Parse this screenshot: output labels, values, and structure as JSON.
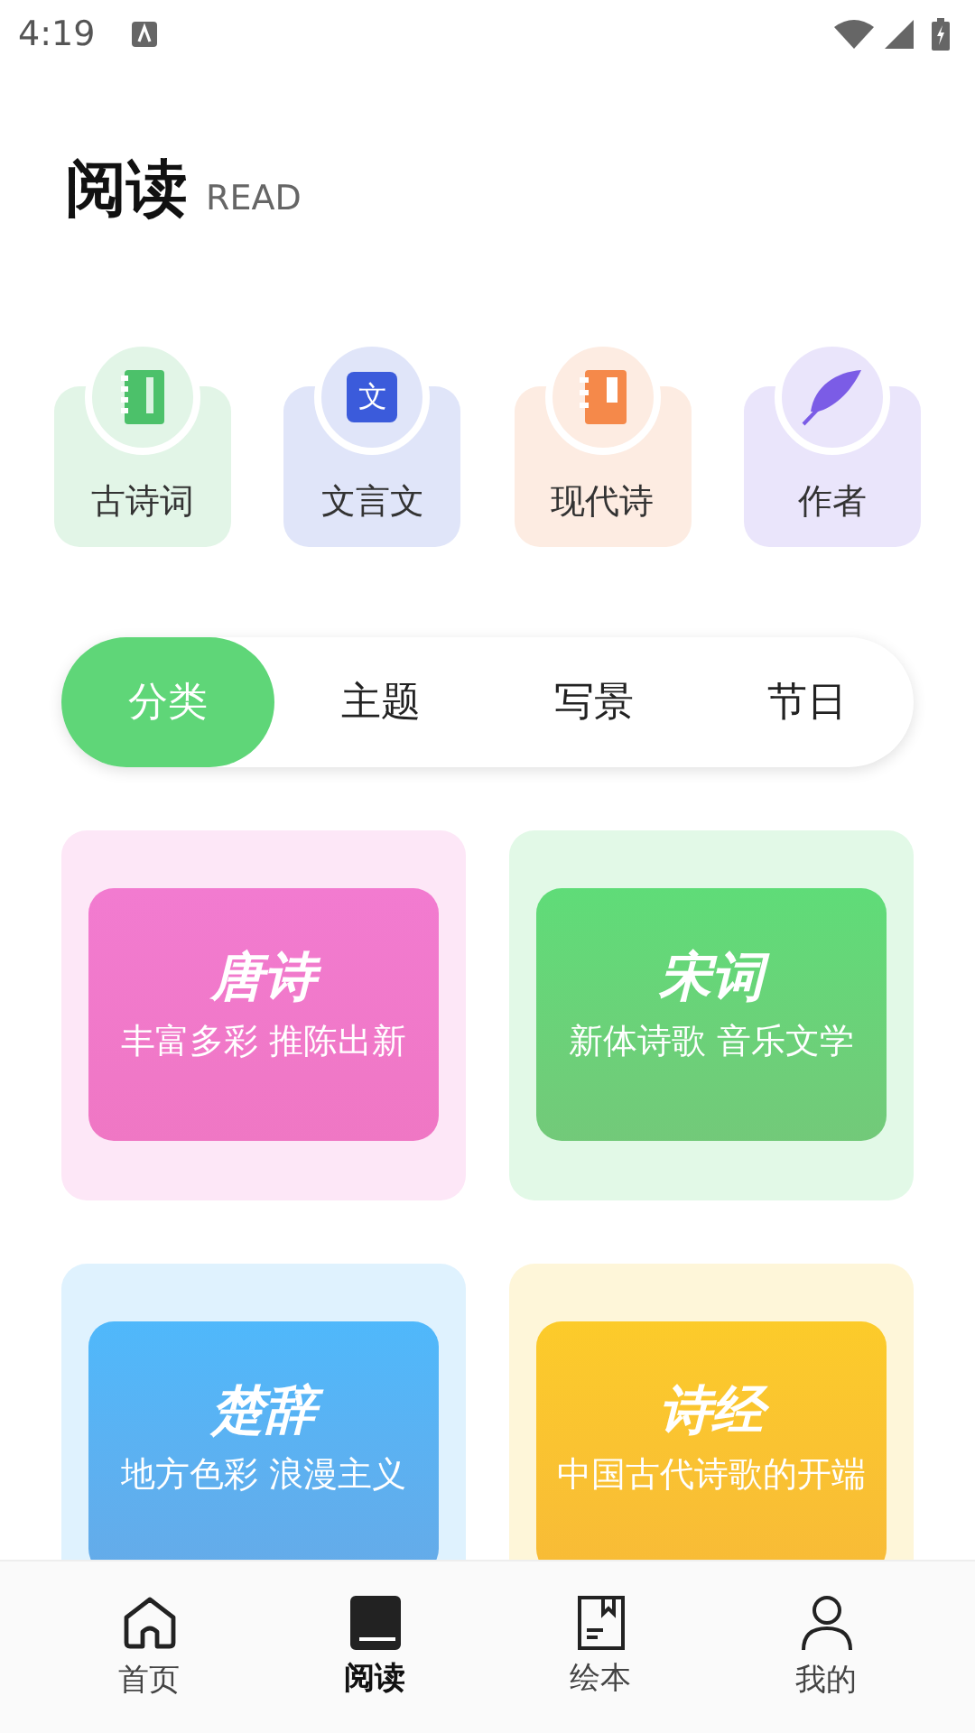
{
  "status_bar": {
    "time": "4:19"
  },
  "header": {
    "title": "阅读",
    "subtitle": "READ"
  },
  "categories": [
    {
      "label": "古诗词",
      "kind": "notebook",
      "color": "#4cc16a"
    },
    {
      "label": "文言文",
      "kind": "glyph",
      "glyph": "文",
      "color": "#3b5bdb"
    },
    {
      "label": "现代诗",
      "kind": "book",
      "color": "#f5894a"
    },
    {
      "label": "作者",
      "kind": "feather",
      "color": "#7b5ce6"
    }
  ],
  "tabs": [
    {
      "label": "分类",
      "selected": true
    },
    {
      "label": "主题",
      "selected": false
    },
    {
      "label": "写景",
      "selected": false
    },
    {
      "label": "节日",
      "selected": false
    }
  ],
  "cards": [
    {
      "title": "唐诗",
      "subtitle": "丰富多彩 推陈出新",
      "color": "#f27bd0"
    },
    {
      "title": "宋词",
      "subtitle": "新体诗歌 音乐文学",
      "color": "#5fdc78"
    },
    {
      "title": "楚辞",
      "subtitle": "地方色彩 浪漫主义",
      "color": "#4fb8fb"
    },
    {
      "title": "诗经",
      "subtitle": "中国古代诗歌的开端",
      "color": "#fccb2a"
    }
  ],
  "bottom_nav": [
    {
      "label": "首页",
      "kind": "home",
      "selected": false
    },
    {
      "label": "阅读",
      "kind": "book",
      "selected": true
    },
    {
      "label": "绘本",
      "kind": "picturebook",
      "selected": false
    },
    {
      "label": "我的",
      "kind": "person",
      "selected": false
    }
  ]
}
